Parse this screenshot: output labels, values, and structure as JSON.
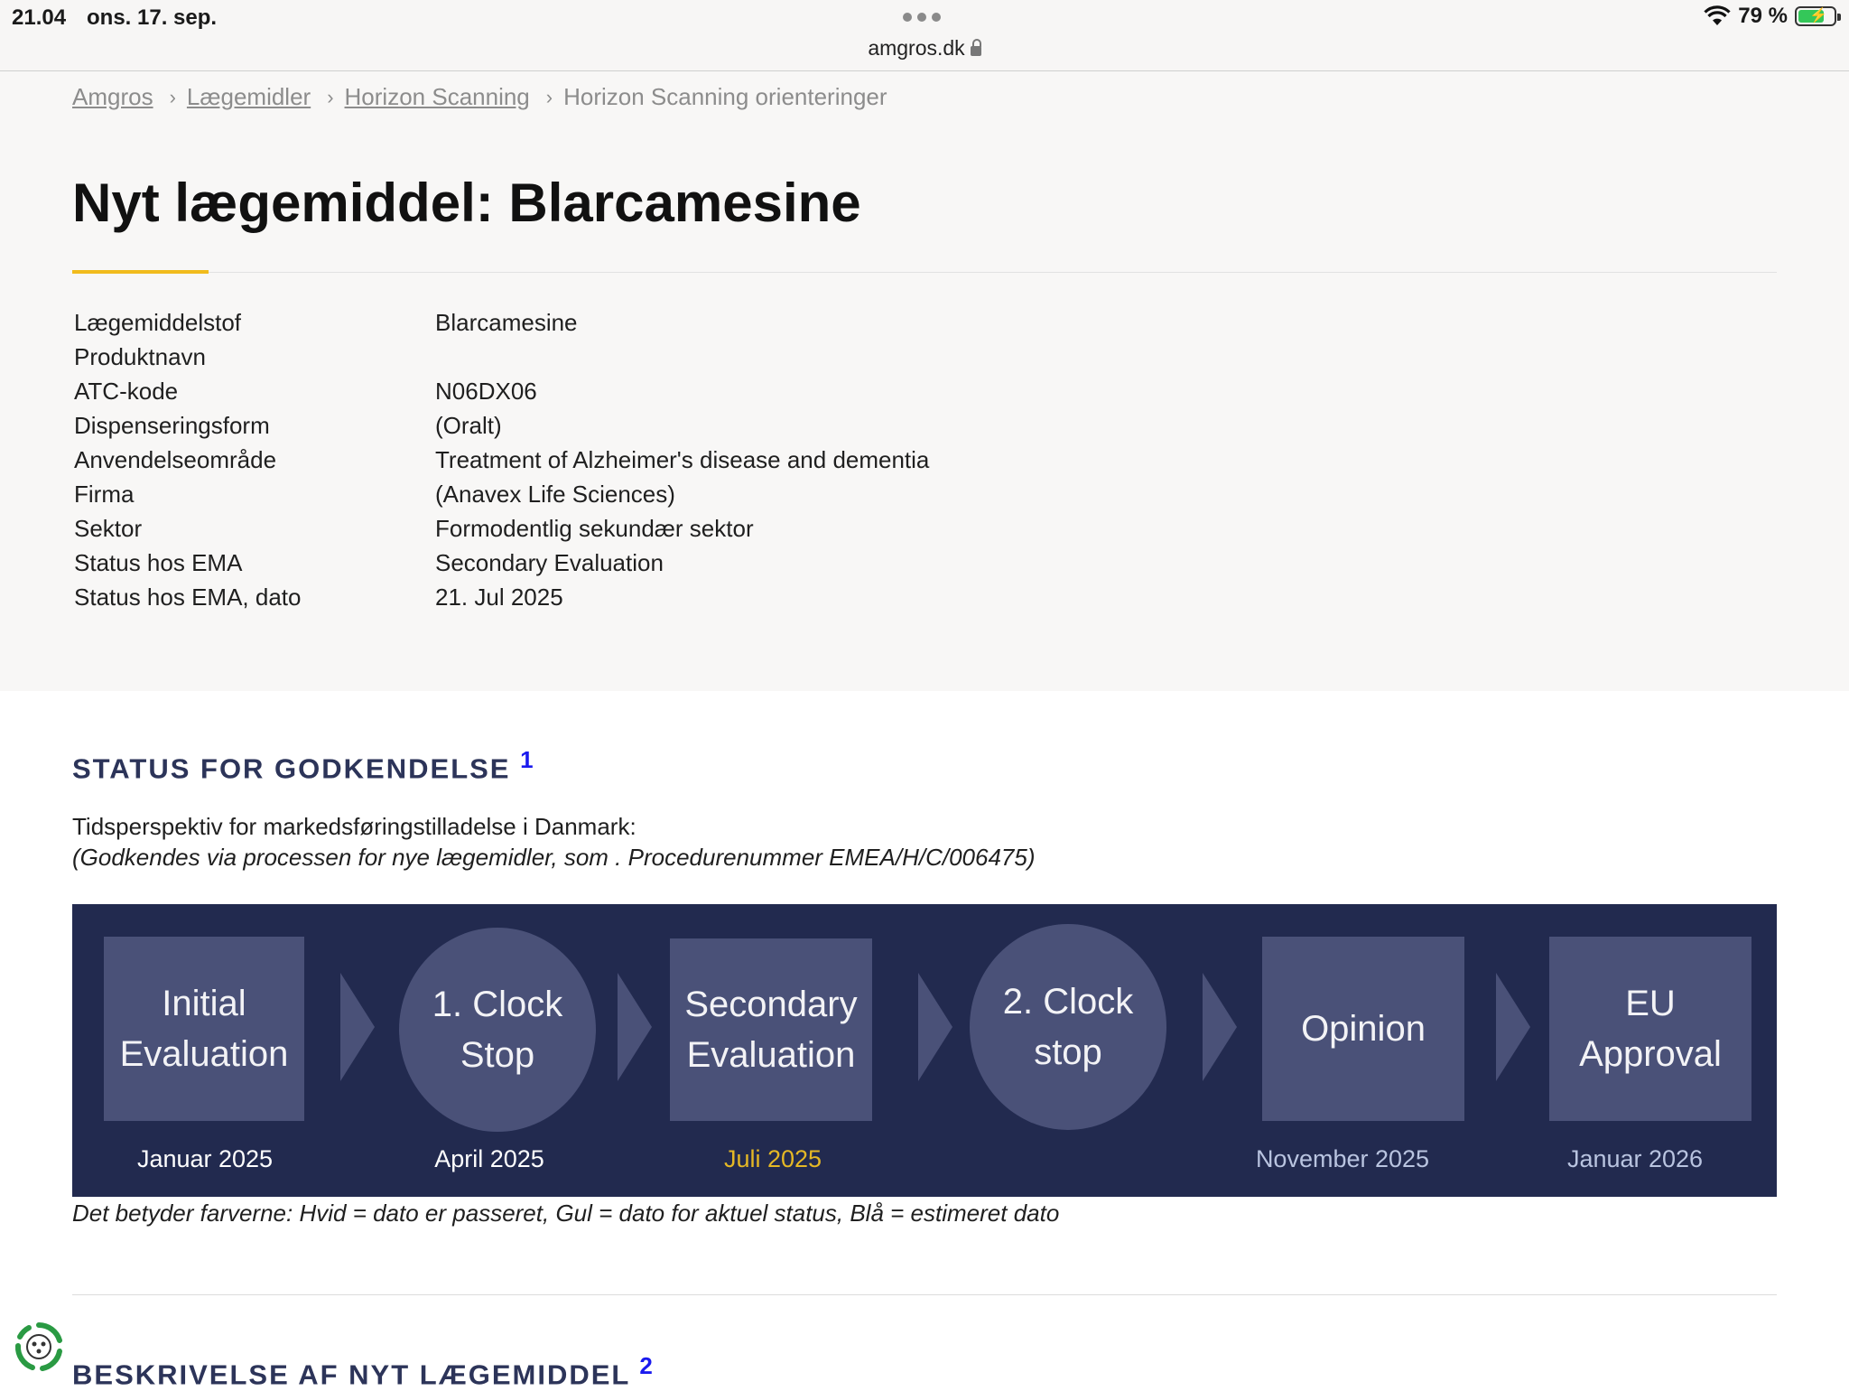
{
  "statusbar": {
    "time": "21.04",
    "date": "ons. 17. sep.",
    "url": "amgros.dk",
    "battery_percent": "79 %",
    "battery_level": 0.79
  },
  "breadcrumb": [
    "Amgros",
    "Lægemidler",
    "Horizon Scanning",
    "Horizon Scanning orienteringer"
  ],
  "title": "Nyt lægemiddel: Blarcamesine",
  "info": [
    {
      "key": "Lægemiddelstof",
      "value": "Blarcamesine"
    },
    {
      "key": "Produktnavn",
      "value": ""
    },
    {
      "key": "ATC-kode",
      "value": "N06DX06"
    },
    {
      "key": "Dispenseringsform",
      "value": "(Oralt)"
    },
    {
      "key": "Anvendelseområde",
      "value": "Treatment of Alzheimer's disease and dementia"
    },
    {
      "key": "Firma",
      "value": "(Anavex Life Sciences)"
    },
    {
      "key": "Sektor",
      "value": "Formodentlig sekundær sektor"
    },
    {
      "key": "Status hos EMA",
      "value": "Secondary Evaluation"
    },
    {
      "key": "Status hos EMA, dato",
      "value": "21. Jul 2025"
    }
  ],
  "status_section": {
    "heading": "STATUS FOR GODKENDELSE",
    "footnote": "1",
    "line1": "Tidsperspektiv for markedsføringstilladelse i Danmark:",
    "line2": "(Godkendes via processen for nye lægemidler, som . Procedurenummer EMEA/H/C/006475)",
    "steps": [
      {
        "line1": "Initial",
        "line2": "Evaluation",
        "date": "Januar 2025",
        "date_color": "#ffffff"
      },
      {
        "line1": "1. Clock",
        "line2": "Stop",
        "date": "April 2025",
        "date_color": "#ffffff"
      },
      {
        "line1": "Secondary",
        "line2": "Evaluation",
        "date": "Juli 2025",
        "date_color": "#e5b825"
      },
      {
        "line1": "2. Clock",
        "line2": "stop",
        "date": "",
        "date_color": "#ffffff"
      },
      {
        "line1": "Opinion",
        "line2": "",
        "date": "November 2025",
        "date_color": "#b9c4e0"
      },
      {
        "line1": "EU",
        "line2": "Approval",
        "date": "Januar 2026",
        "date_color": "#b9c4e0"
      }
    ],
    "legend": "Det betyder farverne: Hvid = dato er passeret, Gul = dato for aktuel status, Blå = estimeret dato"
  },
  "description_section": {
    "heading": "BESKRIVELSE AF NYT LÆGEMIDDEL",
    "footnote": "2"
  },
  "icons": {
    "chat": "chat-support-icon",
    "wifi": "wifi-icon",
    "lock": "lock-icon",
    "battery": "battery-icon"
  }
}
